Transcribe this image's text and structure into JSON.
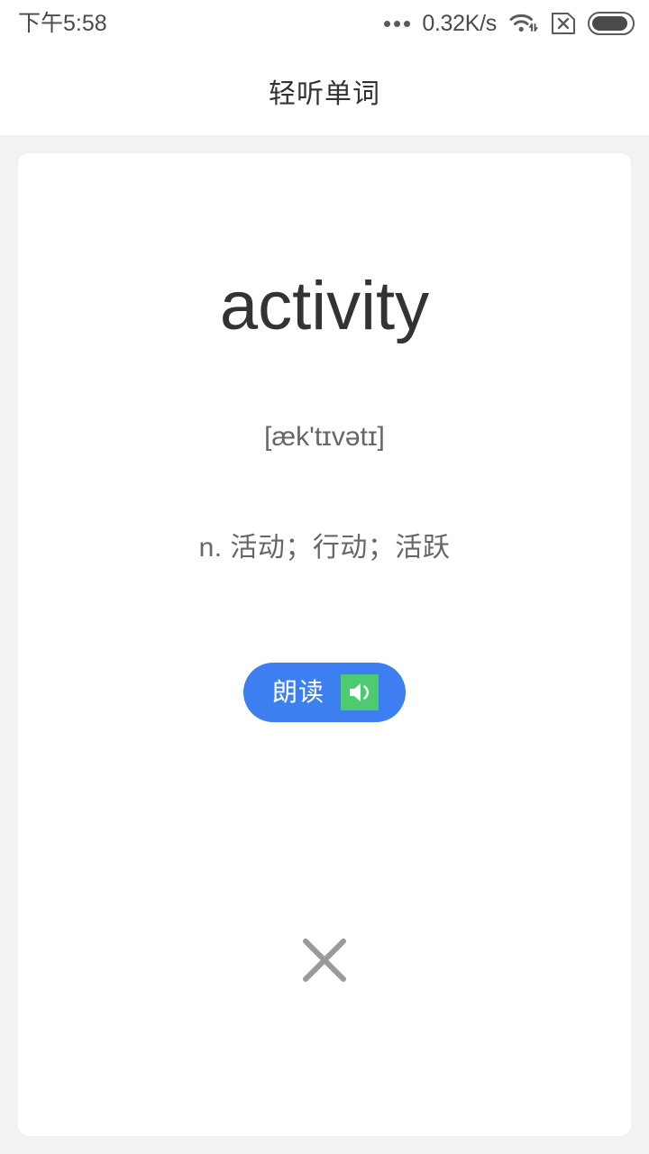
{
  "status_bar": {
    "time": "下午5:58",
    "network_speed": "0.32K/s",
    "icons": {
      "more_dots": "more-dots-icon",
      "wifi": "wifi-icon",
      "sim_disabled": "sim-card-x-icon",
      "battery": "battery-icon"
    }
  },
  "header": {
    "title": "轻听单词"
  },
  "card": {
    "word": "activity",
    "phonetic": "[æk'tɪvətɪ]",
    "definition": "n. 活动；行动；活跃",
    "speak_button": {
      "label": "朗读",
      "icon": "speaker-icon"
    },
    "close_button": {
      "icon": "close-x-icon"
    }
  },
  "colors": {
    "accent_blue": "#3d7ef0",
    "speaker_green": "#4ecb71",
    "page_background": "#f2f2f2",
    "card_background": "#ffffff",
    "primary_text": "#333333",
    "secondary_text": "#666666",
    "close_gray": "#999999"
  }
}
